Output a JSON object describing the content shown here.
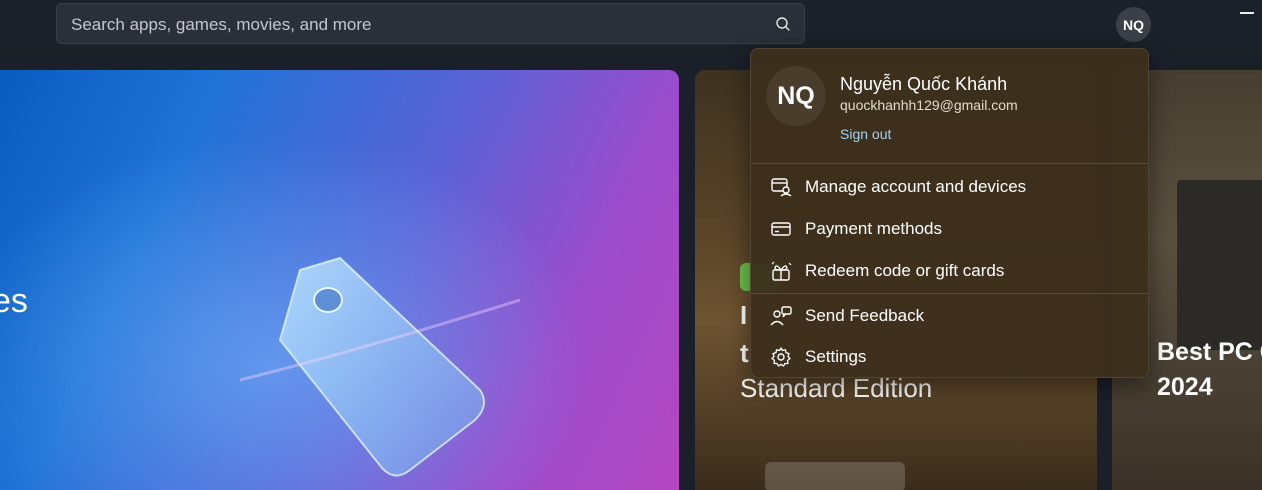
{
  "search": {
    "placeholder": "Search apps, games, movies, and more"
  },
  "header": {
    "avatar_initials": "NQ"
  },
  "hero": {
    "title_partial": "es"
  },
  "cards": [
    {
      "line1": "I",
      "line2": "t",
      "line3": "Standard Edition"
    },
    {
      "line1": "Best PC G",
      "line2": "2024"
    }
  ],
  "account": {
    "initials": "NQ",
    "name": "Nguyễn Quốc Khánh",
    "email": "quockhanhh129@gmail.com",
    "sign_out": "Sign out",
    "menu": [
      {
        "label": "Manage account and devices",
        "icon": "manage-account-icon"
      },
      {
        "label": "Payment methods",
        "icon": "credit-card-icon"
      },
      {
        "label": "Redeem code or gift cards",
        "icon": "gift-icon"
      },
      {
        "label": "Send Feedback",
        "icon": "feedback-icon"
      },
      {
        "label": "Settings",
        "icon": "gear-icon"
      }
    ]
  },
  "colors": {
    "accent_link": "#9fd3ee",
    "flyout_bg": "#3c2f1c",
    "badge_green": "#6cc04a"
  }
}
